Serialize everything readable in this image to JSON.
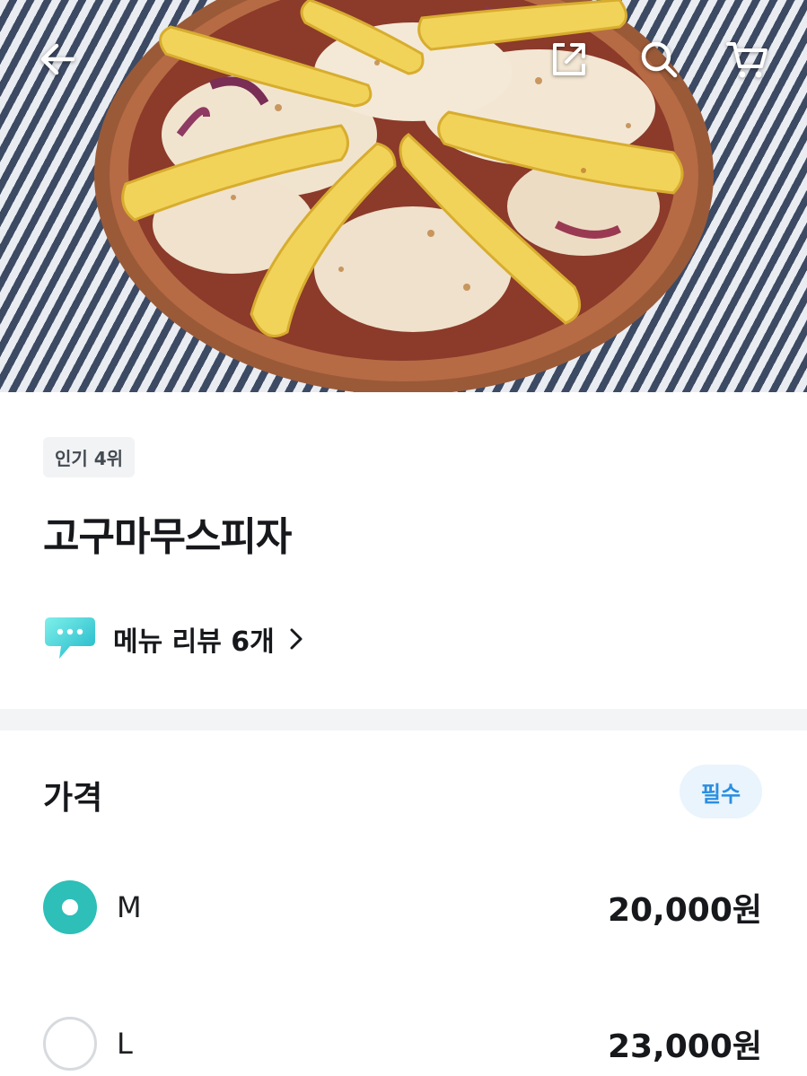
{
  "header": {
    "back_icon": "arrow-left-icon",
    "share_icon": "share-external-icon",
    "search_icon": "search-icon",
    "cart_icon": "cart-icon"
  },
  "menu": {
    "rank_badge": "인기 4위",
    "title": "고구마무스피자",
    "review_link": "메뉴 리뷰 6개"
  },
  "price_section": {
    "title": "가격",
    "required_badge": "필수",
    "options": [
      {
        "label": "M",
        "price": "20,000원",
        "selected": true
      },
      {
        "label": "L",
        "price": "23,000원",
        "selected": false
      }
    ]
  },
  "colors": {
    "accent": "#2dbfb8",
    "required_text": "#2a8ee0",
    "required_bg": "#e9f4fc"
  }
}
